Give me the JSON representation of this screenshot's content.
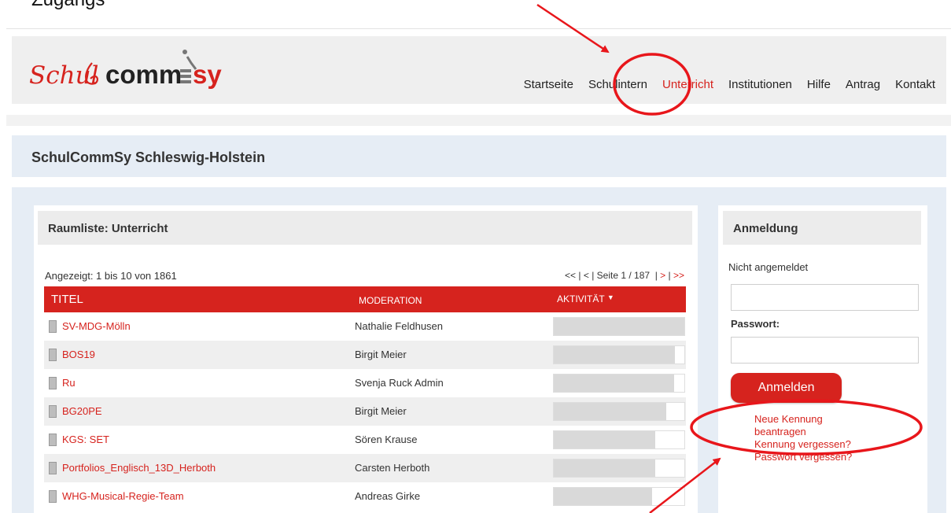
{
  "header_fragment": "Zugangs",
  "brand": {
    "logo_text_left": "Schul",
    "logo_text_mid": "comm",
    "logo_text_right": "sy",
    "accent_color": "#d6231e"
  },
  "nav": {
    "items": [
      {
        "label": "Startseite",
        "active": false
      },
      {
        "label": "Schulintern",
        "active": false
      },
      {
        "label": "Unterricht",
        "active": true
      },
      {
        "label": "Institutionen",
        "active": false
      },
      {
        "label": "Hilfe",
        "active": false
      },
      {
        "label": "Antrag",
        "active": false
      },
      {
        "label": "Kontakt",
        "active": false
      }
    ]
  },
  "site_title": "SchulCommSy Schleswig-Holstein",
  "room_list": {
    "title": "Raumliste: Unterricht",
    "shown": "Angezeigt: 1 bis 10 von 1861",
    "pager": {
      "first": "<<",
      "prev": "<",
      "page": "Seite 1 / 187",
      "next": ">",
      "last": ">>"
    },
    "columns": {
      "title": "TITEL",
      "moderation": "MODERATION",
      "activity": "AKTIVITÄT"
    },
    "rows": [
      {
        "title": "SV-MDG-Mölln",
        "moderation": "Nathalie Feldhusen",
        "activity": 1.0
      },
      {
        "title": "BOS19",
        "moderation": "Birgit Meier",
        "activity": 0.93
      },
      {
        "title": "Ru",
        "moderation": "Svenja Ruck Admin",
        "activity": 0.92
      },
      {
        "title": "BG20PE",
        "moderation": "Birgit Meier",
        "activity": 0.86
      },
      {
        "title": "KGS: SET",
        "moderation": "Sören Krause",
        "activity": 0.78
      },
      {
        "title": "Portfolios_Englisch_13D_Herboth",
        "moderation": "Carsten Herboth",
        "activity": 0.78
      },
      {
        "title": "WHG-Musical-Regie-Team",
        "moderation": "Andreas Girke",
        "activity": 0.75
      }
    ]
  },
  "login": {
    "title": "Anmeldung",
    "status": "Nicht angemeldet",
    "username_value": "",
    "password_label": "Passwort:",
    "password_value": "",
    "button": "Anmelden",
    "links": [
      "Neue Kennung beantragen",
      "Kennung vergessen?",
      "Passwort vergessen?"
    ]
  },
  "annotation_color": "#e8161b"
}
